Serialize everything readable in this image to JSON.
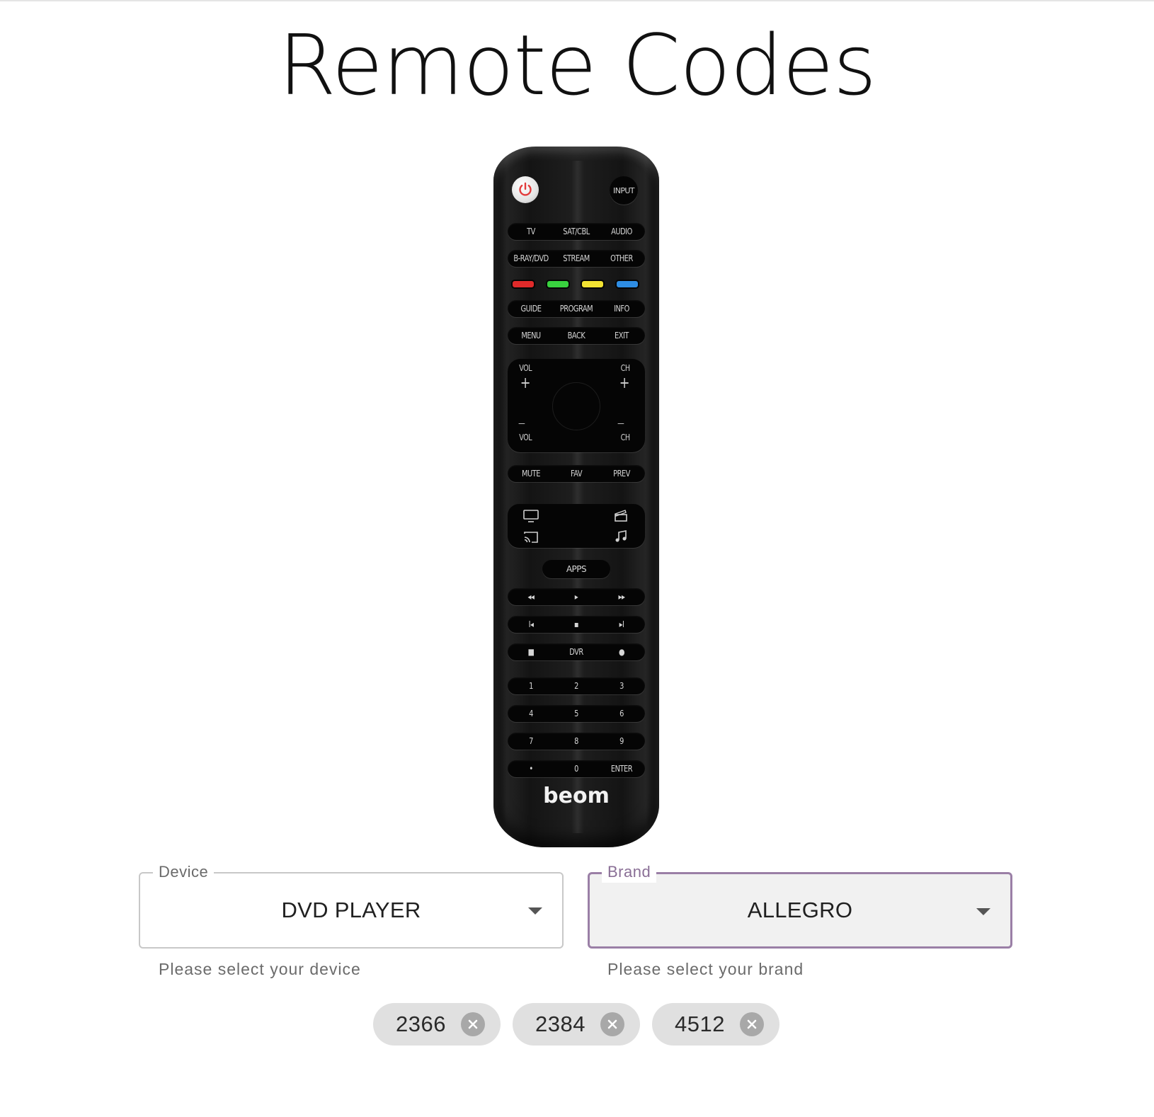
{
  "page": {
    "title": "Remote Codes"
  },
  "remote": {
    "power_label": "",
    "input_label": "INPUT",
    "rows": [
      [
        "TV",
        "SAT/CBL",
        "AUDIO"
      ],
      [
        "B-RAY/DVD",
        "STREAM",
        "OTHER"
      ],
      [
        "GUIDE",
        "PROGRAM",
        "INFO"
      ],
      [
        "MENU",
        "BACK",
        "EXIT"
      ]
    ],
    "color_buttons": [
      "#e02a2a",
      "#39d23f",
      "#f3e332",
      "#2e8de4"
    ],
    "vol_label": "VOL",
    "ch_label": "CH",
    "plus": "+",
    "minus": "—",
    "row_mute": [
      "MUTE",
      "FAV",
      "PREV"
    ],
    "apps_label": "APPS",
    "transport_1": [
      "◂◂",
      "▸",
      "▸▸"
    ],
    "transport_2": [
      "I◂",
      "▪",
      "▸I"
    ],
    "dvr_row": [
      "■",
      "DVR",
      "●"
    ],
    "keypad": [
      [
        "1",
        "2",
        "3"
      ],
      [
        "4",
        "5",
        "6"
      ],
      [
        "7",
        "8",
        "9"
      ],
      [
        "•",
        "0",
        "ENTER"
      ]
    ],
    "brand_logo": "beom"
  },
  "device_select": {
    "label": "Device",
    "value": "DVD PLAYER",
    "helper": "Please select your device"
  },
  "brand_select": {
    "label": "Brand",
    "value": "ALLEGRO",
    "helper": "Please select your brand"
  },
  "codes": [
    {
      "label": "2366"
    },
    {
      "label": "2384"
    },
    {
      "label": "4512"
    }
  ]
}
